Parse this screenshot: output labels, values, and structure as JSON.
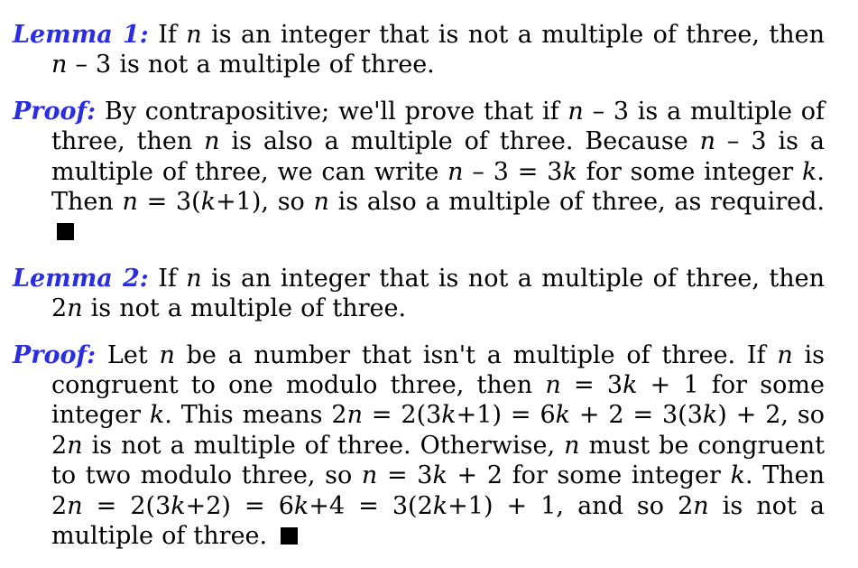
{
  "blocks": [
    {
      "label": "Lemma 1:",
      "text": "If n is an integer that is not a multiple of three, then n – 3 is not a multiple of three."
    },
    {
      "label": "Proof:",
      "text": "By contrapositive; we'll prove that if n – 3 is a multiple of three, then n is also a multiple of three. Because n – 3 is a multiple of three, we can write n – 3 = 3k for some integer k. Then n = 3(k+1), so n is also a multiple of three, as required."
    },
    {
      "label": "Lemma 2:",
      "text": "If n is an integer that is not a multiple of three, then 2n is not a multiple of three."
    },
    {
      "label": "Proof:",
      "text": "Let n be a number that isn't a multiple of three. If n is congruent to one modulo three, then n = 3k + 1 for some integer k. This means 2n = 2(3k+1) = 6k + 2 = 3(3k) + 2, so 2n is not a multiple of three. Otherwise, n must be congruent to two modulo three, so n = 3k + 2 for some integer k. Then 2n = 2(3k+2) = 6k+4 = 3(2k+1) + 1, and so 2n is not a multiple of three."
    }
  ],
  "colors": {
    "label": "#2a2ee0",
    "text": "#000000",
    "qed_box": "#000000"
  }
}
